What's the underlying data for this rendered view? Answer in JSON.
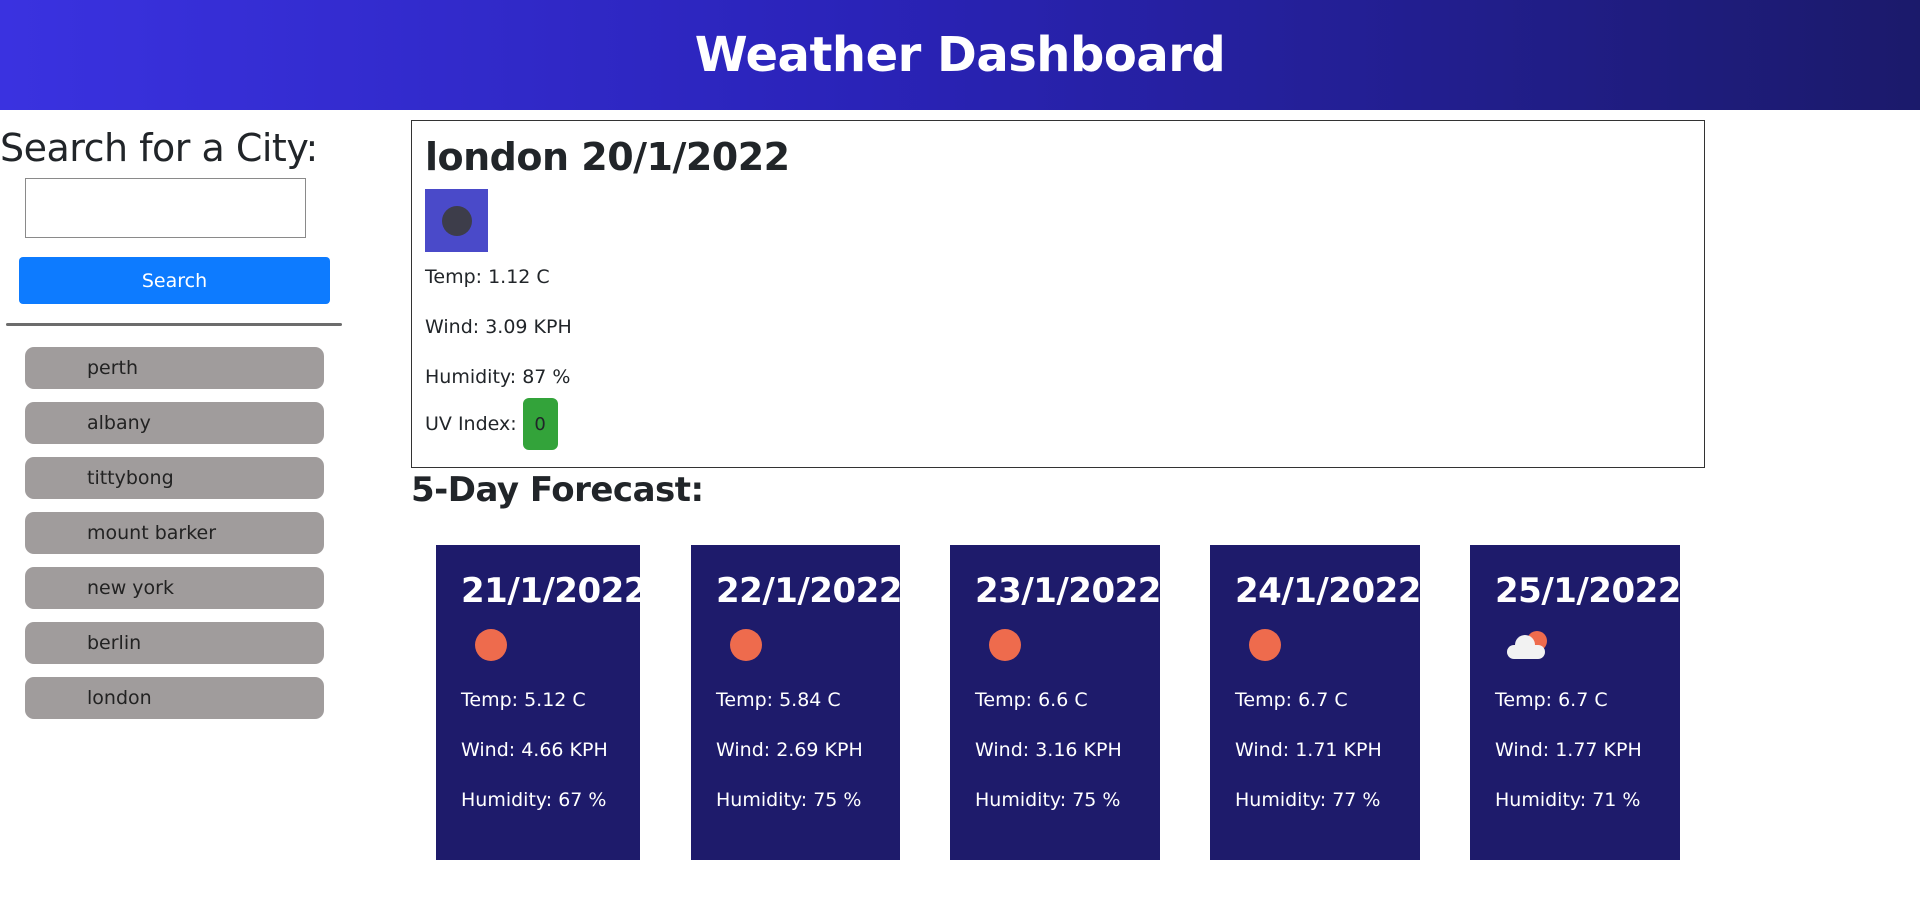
{
  "header": {
    "title": "Weather Dashboard"
  },
  "colors": {
    "header_gradient_start": "#3a32e0",
    "header_gradient_end": "#1b1a6b",
    "search_button": "#0d7bff",
    "history_item": "#a09c9c",
    "uv_badge": "#33a33a",
    "forecast_card": "#1e1b6b",
    "sun": "#ee6b4d"
  },
  "sidebar": {
    "heading": "Search for a City:",
    "search_value": "",
    "search_placeholder": "",
    "search_button_label": "Search",
    "history": [
      {
        "label": "perth"
      },
      {
        "label": "albany"
      },
      {
        "label": "tittybong"
      },
      {
        "label": "mount barker"
      },
      {
        "label": "new york"
      },
      {
        "label": "berlin"
      },
      {
        "label": "london"
      }
    ]
  },
  "current": {
    "title": "london 20/1/2022",
    "icon": "night-clear-icon",
    "temp": "Temp: 1.12 C",
    "wind": "Wind: 3.09 KPH",
    "humidity": "Humidity: 87 %",
    "uv_label": "UV Index:",
    "uv_value": "0"
  },
  "forecast": {
    "heading": "5-Day Forecast:",
    "days": [
      {
        "date": "21/1/2022",
        "icon": "sun-icon",
        "temp": "Temp: 5.12 C",
        "wind": "Wind: 4.66 KPH",
        "humidity": "Humidity: 67 %"
      },
      {
        "date": "22/1/2022",
        "icon": "sun-icon",
        "temp": "Temp: 5.84 C",
        "wind": "Wind: 2.69 KPH",
        "humidity": "Humidity: 75 %"
      },
      {
        "date": "23/1/2022",
        "icon": "sun-icon",
        "temp": "Temp: 6.6 C",
        "wind": "Wind: 3.16 KPH",
        "humidity": "Humidity: 75 %"
      },
      {
        "date": "24/1/2022",
        "icon": "sun-icon",
        "temp": "Temp: 6.7 C",
        "wind": "Wind: 1.71 KPH",
        "humidity": "Humidity: 77 %"
      },
      {
        "date": "25/1/2022",
        "icon": "cloud-sun-icon",
        "temp": "Temp: 6.7 C",
        "wind": "Wind: 1.77 KPH",
        "humidity": "Humidity: 71 %"
      }
    ]
  }
}
